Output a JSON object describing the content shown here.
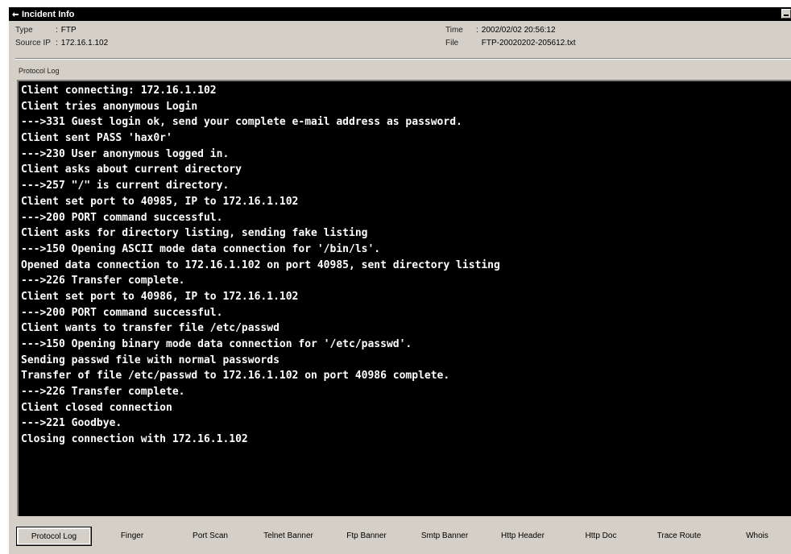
{
  "window": {
    "title": "Incident Info"
  },
  "info": {
    "type_label": "Type",
    "type_value": "FTP",
    "source_ip_label": "Source IP",
    "source_ip_value": "172.16.1.102",
    "time_label": "Time",
    "time_value": "2002/02/02 20:56:12",
    "file_label": "File",
    "file_value": "FTP-20020202-205612.txt",
    "separator": ":"
  },
  "log": {
    "label": "Protocol Log",
    "lines": [
      "Client connecting: 172.16.1.102",
      "Client tries anonymous Login",
      "--->331 Guest login ok, send your complete e-mail address as password.",
      "Client sent PASS 'hax0r'",
      "--->230 User anonymous logged in.",
      "Client asks about current directory",
      "--->257 \"/\" is current directory.",
      "Client set port to 40985, IP to 172.16.1.102",
      "--->200 PORT command successful.",
      "Client asks for directory listing, sending fake listing",
      "--->150 Opening ASCII mode data connection for '/bin/ls'.",
      "Opened data connection to 172.16.1.102 on port 40985, sent directory listing",
      "--->226 Transfer complete.",
      "Client set port to 40986, IP to 172.16.1.102",
      "--->200 PORT command successful.",
      "Client wants to transfer file /etc/passwd",
      "--->150 Opening binary mode data connection for '/etc/passwd'.",
      "Sending passwd file with normal passwords",
      "Transfer of file /etc/passwd to 172.16.1.102 on port 40986 complete.",
      "--->226 Transfer complete.",
      "Client closed connection",
      "--->221 Goodbye.",
      "Closing connection with 172.16.1.102"
    ]
  },
  "tabs": [
    {
      "label": "Protocol Log",
      "active": true
    },
    {
      "label": "Finger",
      "active": false
    },
    {
      "label": "Port Scan",
      "active": false
    },
    {
      "label": "Telnet Banner",
      "active": false
    },
    {
      "label": "Ftp Banner",
      "active": false
    },
    {
      "label": "Smtp Banner",
      "active": false
    },
    {
      "label": "Http Header",
      "active": false
    },
    {
      "label": "Http Doc",
      "active": false
    },
    {
      "label": "Trace Route",
      "active": false
    },
    {
      "label": "Whois",
      "active": false
    }
  ]
}
